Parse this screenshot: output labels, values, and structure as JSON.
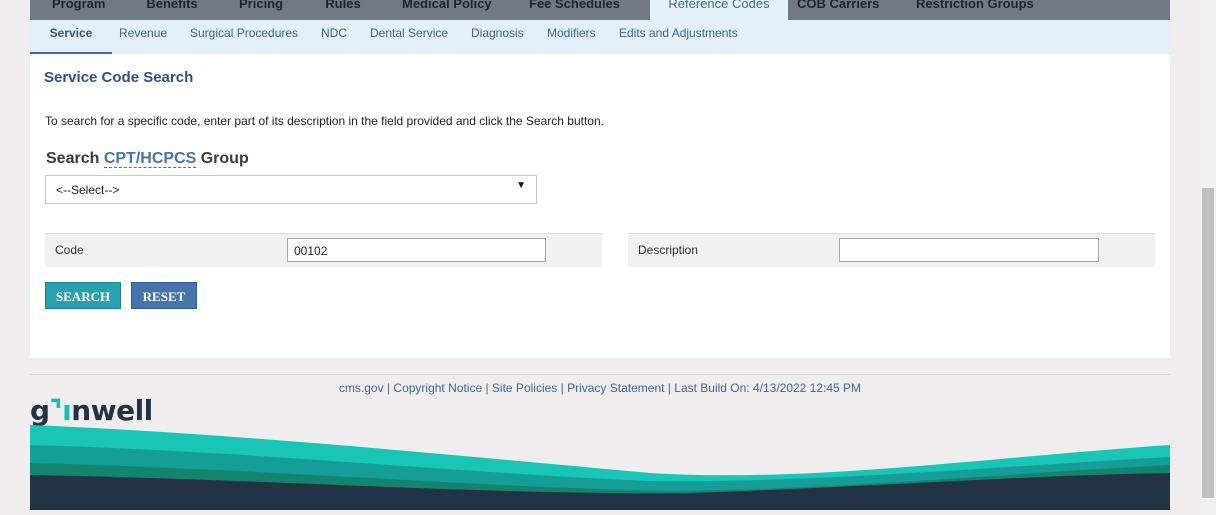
{
  "top_nav": {
    "items": [
      {
        "label": "Program"
      },
      {
        "label": "Benefits"
      },
      {
        "label": "Pricing"
      },
      {
        "label": "Rules"
      },
      {
        "label": "Medical Policy"
      },
      {
        "label": "Fee Schedules"
      },
      {
        "label": "Reference Codes",
        "active": true
      },
      {
        "label": "COB Carriers"
      },
      {
        "label": "Restriction Groups"
      }
    ]
  },
  "sub_nav": {
    "items": [
      {
        "label": "Service",
        "active": true
      },
      {
        "label": "Revenue"
      },
      {
        "label": "Surgical Procedures"
      },
      {
        "label": "NDC"
      },
      {
        "label": "Dental Service"
      },
      {
        "label": "Diagnosis"
      },
      {
        "label": "Modifiers"
      },
      {
        "label": "Edits and Adjustments"
      }
    ]
  },
  "main": {
    "title": "Service Code Search",
    "intro": "To search for a specific code, enter part of its description in the field provided and click the Search button.",
    "search_prefix": "Search",
    "search_abbr": "CPT/HCPCS",
    "search_suffix": "Group",
    "select_value": "<--Select-->",
    "code_label": "Code",
    "code_value": "00102",
    "description_label": "Description",
    "description_value": "",
    "search_button": "SEARCH",
    "reset_button": "RESET"
  },
  "footer": {
    "links": [
      "cms.gov",
      "Copyright Notice",
      "Site Policies",
      "Privacy Statement"
    ],
    "separator": " | ",
    "build": "Last Build On: 4/13/2022 12:45 PM",
    "logo_prefix": "g",
    "logo_mark": "⌝ı",
    "logo_suffix": "nwell"
  },
  "colors": {
    "accent": "#3f6aa1",
    "teal": "#14bfae",
    "dark": "#243343"
  }
}
